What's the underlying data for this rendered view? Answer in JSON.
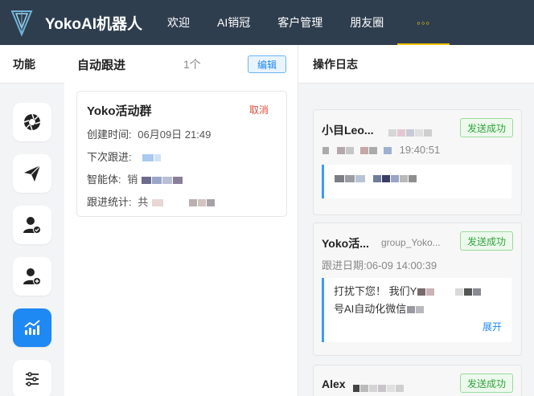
{
  "brand": "YokoAI机器人",
  "nav": [
    "欢迎",
    "AI销冠",
    "客户管理",
    "朋友圈",
    "◦◦◦"
  ],
  "sidebar": {
    "title": "功能"
  },
  "panel": {
    "title": "自动跟进",
    "count": "1个",
    "edit_label": "编辑"
  },
  "task": {
    "name": "Yoko活动群",
    "cancel_label": "取消",
    "created_label": "创建时间:",
    "created_value": "06月09日 21:49",
    "next_label": "下次跟进:",
    "agent_label": "智能体:",
    "agent_value": "销",
    "stats_label": "跟进统计:",
    "stats_value": "共"
  },
  "log_panel": {
    "title": "操作日志"
  },
  "logs": [
    {
      "name": "小目Leo...",
      "sub": "",
      "status": "发送成功",
      "meta": "19:40:51",
      "body": ""
    },
    {
      "name": "Yoko活...",
      "sub": "group_Yoko...",
      "status": "发送成功",
      "meta": "跟进日期:06-09 14:00:39",
      "body_line1": "打扰下您！ 我们Y",
      "body_line2": "号AI自动化微信",
      "expand": "展开"
    },
    {
      "name": "Alex",
      "sub": "",
      "status": "发送成功"
    }
  ],
  "colors": {
    "header_bg": "#2f3e4f",
    "accent": "#1e88f3",
    "more": "#f0c20a",
    "success": "#2ea53b",
    "danger": "#e84a3c"
  },
  "icons": [
    "aperture-icon",
    "paper-plane-icon",
    "user-check-icon",
    "user-add-icon",
    "trend-chart-icon",
    "sliders-icon"
  ]
}
